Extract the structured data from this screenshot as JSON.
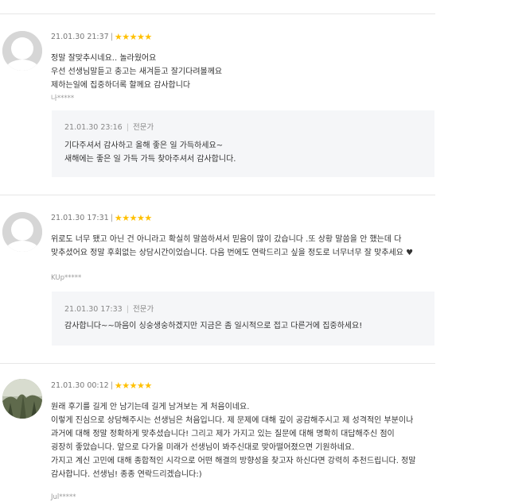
{
  "reviews": [
    {
      "date": "21.01.30 21:37",
      "separator": "|",
      "rating": 5,
      "avatar": "default-user-icon",
      "content": "정말 잘맞추시네요.. 놀라웠어요\n우선 선생님말듣고 충고는 새겨듣고 잘기다려볼께요\n제하는일에 집중하더록 할께요 감사합니다",
      "author": "나*****",
      "reply": {
        "date": "21.01.30 23:16",
        "separator": "|",
        "responder": "전문가",
        "text": "기다주셔서 감사하고 올해 좋은 일 가득하세요~\n새해에는 좋은 일 가득 가득 찾아주셔서 감사합니다."
      }
    },
    {
      "date": "21.01.30 17:31",
      "separator": "|",
      "rating": 5,
      "avatar": "default-user-icon",
      "content": "위로도 너무 됐고 아닌 건 아니라고 확실히 말씀하셔서 믿음이 많이 갔습니다 .또 상황 말씀을 안 했는데 다 맞추셨어요 정말 후회없는 상담시간이었습니다. 다음 번에도 연락드리고 싶을 정도로 너무너무 잘 맞추세요 ♥",
      "author": "KUp*****",
      "reply": {
        "date": "21.01.30 17:33",
        "separator": "|",
        "responder": "전문가",
        "text": "감사합니다~~마음이 싱숭생숭하겠지만 지금은 좀 일시적으로 접고 다른거에 집중하세요!"
      }
    },
    {
      "date": "21.01.30 00:12",
      "separator": "|",
      "rating": 5,
      "avatar": "user-photo",
      "content": "원래 후기를 길게 안 남기는데 길게 남겨보는 게 처음이네요.\n이렇게 진심으로 상담해주시는 선생님은 처음입니다. 제 문제에 대해 깊이 공감해주시고 제 성격적인 부분이나 과거에 대해 정말 정확하게 맞추셨습니다! 그리고 제가 가지고 있는 질문에 대해 명확히 대답해주신 점이 굉장히 좋았습니다. 앞으로 다가올 미래가 선생님이 봐주신대로 맞아떨어졌으면 기원하네요.\n가지고 계신 고민에 대해 종합적인 시각으로 어떤 해결의 방향성을 찾고자 하신다면 강력히 추천드립니다. 정말 감사합니다. 선생님! 종종 연락드리겠습니다:)",
      "author": "Jul*****"
    }
  ],
  "colors": {
    "star": "#ffc000",
    "reply_bg": "#f5f6f8",
    "divider": "#e6e6e6"
  }
}
